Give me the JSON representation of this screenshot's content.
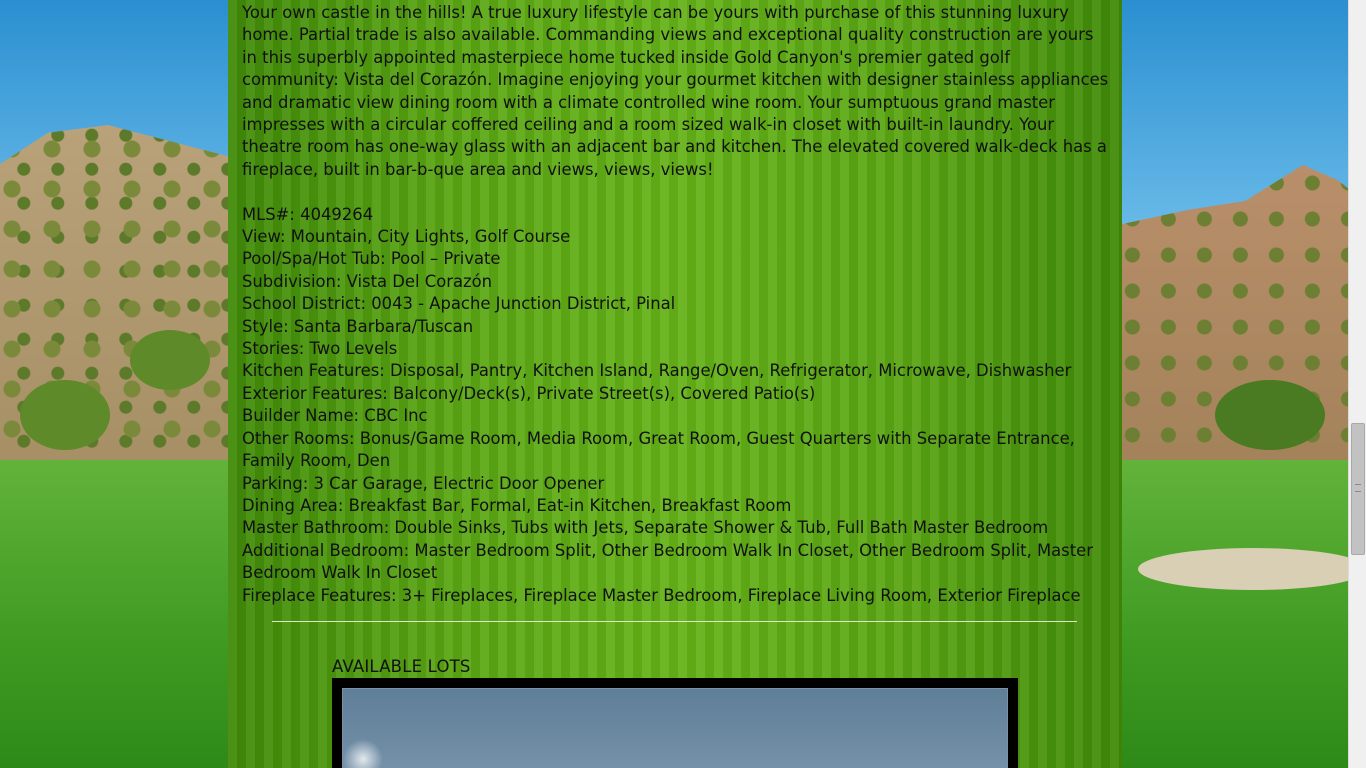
{
  "listing": {
    "description": "Your own castle in the hills! A true luxury lifestyle can be yours with purchase of this stunning luxury home. Partial trade is also available. Commanding views and exceptional quality construction are yours in this superbly appointed masterpiece home tucked inside Gold Canyon's premier gated golf community: Vista del Corazón. Imagine enjoying your gourmet kitchen with designer stainless appliances and dramatic view dining room with a climate controlled wine room. Your sumptuous grand master impresses with a circular coffered ceiling and a room sized walk-in closet with built-in laundry. Your theatre room has one-way glass with an adjacent bar and kitchen. The elevated covered walk-deck has a fireplace, built in bar-b-que area and views, views, views!",
    "features": [
      "MLS#: 4049264",
      "View: Mountain, City Lights, Golf Course",
      "Pool/Spa/Hot Tub: Pool – Private",
      "Subdivision: Vista Del Corazón",
      "School District: 0043 - Apache Junction District, Pinal",
      "Style: Santa Barbara/Tuscan",
      "Stories: Two Levels",
      "Kitchen Features: Disposal, Pantry, Kitchen Island, Range/Oven, Refrigerator, Microwave, Dishwasher",
      "Exterior Features: Balcony/Deck(s), Private Street(s), Covered Patio(s)",
      "Builder Name: CBC Inc",
      "Other Rooms: Bonus/Game Room, Media Room, Great Room, Guest Quarters with Separate Entrance, Family Room, Den",
      "Parking: 3 Car Garage, Electric Door Opener",
      "Dining Area: Breakfast Bar, Formal, Eat-in Kitchen, Breakfast Room",
      "Master Bathroom: Double Sinks, Tubs with Jets, Separate Shower & Tub, Full Bath Master Bedroom",
      "Additional Bedroom: Master Bedroom Split, Other Bedroom Walk In Closet, Other Bedroom Split, Master Bedroom Walk In Closet",
      "Fireplace Features: 3+ Fireplaces, Fireplace Master Bedroom, Fireplace Living Room, Exterior Fireplace"
    ]
  },
  "lots": {
    "heading": "AVAILABLE LOTS"
  },
  "colors": {
    "content_green": "#5aa613",
    "text": "#111111"
  }
}
